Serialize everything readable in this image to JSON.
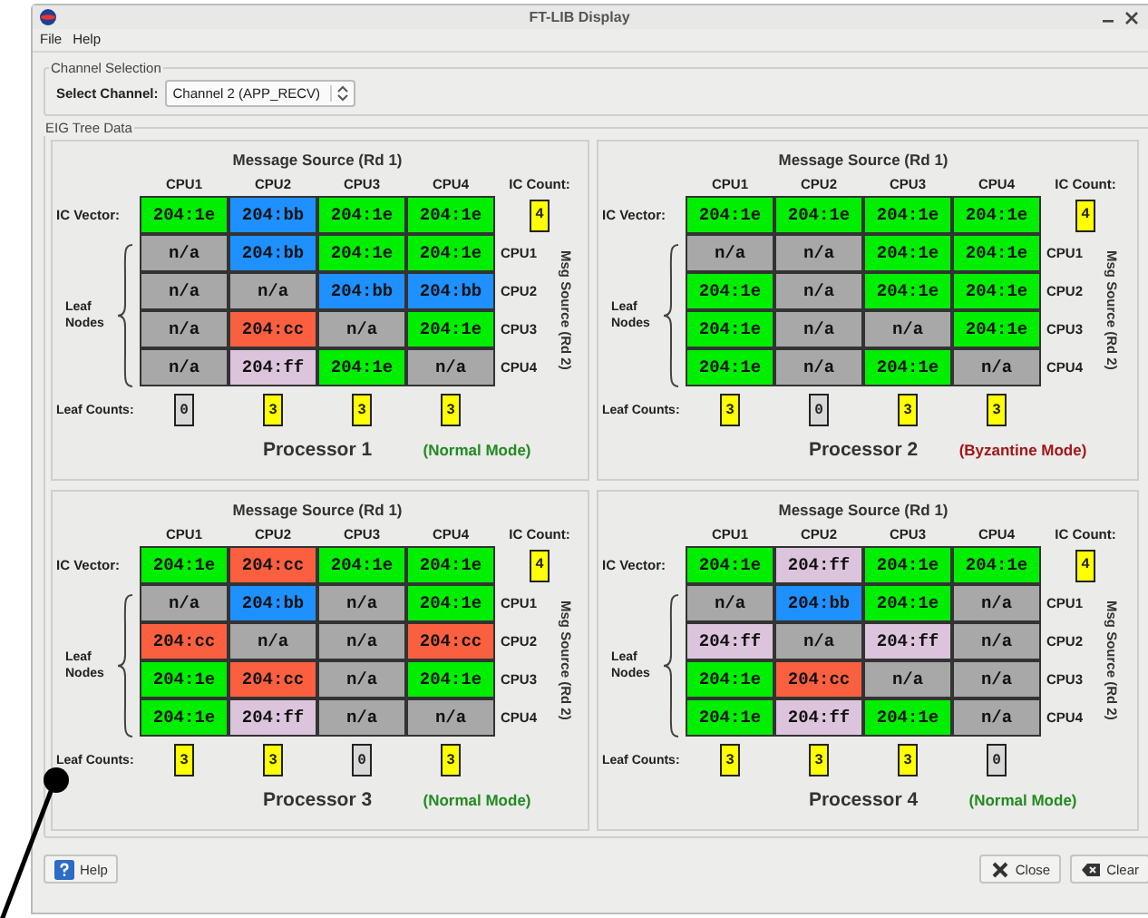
{
  "window": {
    "title": "FT-LIB Display"
  },
  "menu": [
    {
      "label": "File"
    },
    {
      "label": "Help"
    }
  ],
  "channel_selection": {
    "title": "Channel Selection",
    "label": "Select Channel:",
    "value": "Channel 2 (APP_RECV)"
  },
  "eig_tree": {
    "title": "EIG Tree Data",
    "processors": [
      {
        "heading": "Message Source (Rd 1)",
        "columns": [
          "CPU1",
          "CPU2",
          "CPU3",
          "CPU4"
        ],
        "ic_count_label": "IC Count:",
        "ic_vector_label": "IC Vector:",
        "ic_vector": [
          {
            "text": "204:1e",
            "color": "#00ee00"
          },
          {
            "text": "204:bb",
            "color": "#1e90ff"
          },
          {
            "text": "204:1e",
            "color": "#00ee00"
          },
          {
            "text": "204:1e",
            "color": "#00ee00"
          }
        ],
        "ic_count": {
          "text": "4",
          "color": "#ffff00"
        },
        "leaf_label": "Leaf Nodes",
        "side_label": "Msg Source (Rd 2)",
        "leaf_rows": [
          {
            "label": "CPU1",
            "cells": [
              {
                "text": "n/a",
                "color": "#a8a8a8"
              },
              {
                "text": "204:bb",
                "color": "#1e90ff"
              },
              {
                "text": "204:1e",
                "color": "#00ee00"
              },
              {
                "text": "204:1e",
                "color": "#00ee00"
              }
            ]
          },
          {
            "label": "CPU2",
            "cells": [
              {
                "text": "n/a",
                "color": "#a8a8a8"
              },
              {
                "text": "n/a",
                "color": "#a8a8a8"
              },
              {
                "text": "204:bb",
                "color": "#1e90ff"
              },
              {
                "text": "204:bb",
                "color": "#1e90ff"
              }
            ]
          },
          {
            "label": "CPU3",
            "cells": [
              {
                "text": "n/a",
                "color": "#a8a8a8"
              },
              {
                "text": "204:cc",
                "color": "#fa6040"
              },
              {
                "text": "n/a",
                "color": "#a8a8a8"
              },
              {
                "text": "204:1e",
                "color": "#00ee00"
              }
            ]
          },
          {
            "label": "CPU4",
            "cells": [
              {
                "text": "n/a",
                "color": "#a8a8a8"
              },
              {
                "text": "204:ff",
                "color": "#dcc4dc"
              },
              {
                "text": "204:1e",
                "color": "#00ee00"
              },
              {
                "text": "n/a",
                "color": "#a8a8a8"
              }
            ]
          }
        ],
        "leaf_counts_label": "Leaf Counts:",
        "leaf_counts": [
          {
            "text": "0",
            "color": "#d8d8d8"
          },
          {
            "text": "3",
            "color": "#ffff00"
          },
          {
            "text": "3",
            "color": "#ffff00"
          },
          {
            "text": "3",
            "color": "#ffff00"
          }
        ],
        "name": "Processor 1",
        "mode": {
          "text": "(Normal Mode)",
          "color": "#228b22"
        }
      },
      {
        "heading": "Message Source (Rd 1)",
        "columns": [
          "CPU1",
          "CPU2",
          "CPU3",
          "CPU4"
        ],
        "ic_count_label": "IC Count:",
        "ic_vector_label": "IC Vector:",
        "ic_vector": [
          {
            "text": "204:1e",
            "color": "#00ee00"
          },
          {
            "text": "204:1e",
            "color": "#00ee00"
          },
          {
            "text": "204:1e",
            "color": "#00ee00"
          },
          {
            "text": "204:1e",
            "color": "#00ee00"
          }
        ],
        "ic_count": {
          "text": "4",
          "color": "#ffff00"
        },
        "leaf_label": "Leaf Nodes",
        "side_label": "Msg Source (Rd 2)",
        "leaf_rows": [
          {
            "label": "CPU1",
            "cells": [
              {
                "text": "n/a",
                "color": "#a8a8a8"
              },
              {
                "text": "n/a",
                "color": "#a8a8a8"
              },
              {
                "text": "204:1e",
                "color": "#00ee00"
              },
              {
                "text": "204:1e",
                "color": "#00ee00"
              }
            ]
          },
          {
            "label": "CPU2",
            "cells": [
              {
                "text": "204:1e",
                "color": "#00ee00"
              },
              {
                "text": "n/a",
                "color": "#a8a8a8"
              },
              {
                "text": "204:1e",
                "color": "#00ee00"
              },
              {
                "text": "204:1e",
                "color": "#00ee00"
              }
            ]
          },
          {
            "label": "CPU3",
            "cells": [
              {
                "text": "204:1e",
                "color": "#00ee00"
              },
              {
                "text": "n/a",
                "color": "#a8a8a8"
              },
              {
                "text": "n/a",
                "color": "#a8a8a8"
              },
              {
                "text": "204:1e",
                "color": "#00ee00"
              }
            ]
          },
          {
            "label": "CPU4",
            "cells": [
              {
                "text": "204:1e",
                "color": "#00ee00"
              },
              {
                "text": "n/a",
                "color": "#a8a8a8"
              },
              {
                "text": "204:1e",
                "color": "#00ee00"
              },
              {
                "text": "n/a",
                "color": "#a8a8a8"
              }
            ]
          }
        ],
        "leaf_counts_label": "Leaf Counts:",
        "leaf_counts": [
          {
            "text": "3",
            "color": "#ffff00"
          },
          {
            "text": "0",
            "color": "#d8d8d8"
          },
          {
            "text": "3",
            "color": "#ffff00"
          },
          {
            "text": "3",
            "color": "#ffff00"
          }
        ],
        "name": "Processor 2",
        "mode": {
          "text": "(Byzantine Mode)",
          "color": "#a01818"
        }
      },
      {
        "heading": "Message Source (Rd 1)",
        "columns": [
          "CPU1",
          "CPU2",
          "CPU3",
          "CPU4"
        ],
        "ic_count_label": "IC Count:",
        "ic_vector_label": "IC Vector:",
        "ic_vector": [
          {
            "text": "204:1e",
            "color": "#00ee00"
          },
          {
            "text": "204:cc",
            "color": "#fa6040"
          },
          {
            "text": "204:1e",
            "color": "#00ee00"
          },
          {
            "text": "204:1e",
            "color": "#00ee00"
          }
        ],
        "ic_count": {
          "text": "4",
          "color": "#ffff00"
        },
        "leaf_label": "Leaf Nodes",
        "side_label": "Msg Source (Rd 2)",
        "leaf_rows": [
          {
            "label": "CPU1",
            "cells": [
              {
                "text": "n/a",
                "color": "#a8a8a8"
              },
              {
                "text": "204:bb",
                "color": "#1e90ff"
              },
              {
                "text": "n/a",
                "color": "#a8a8a8"
              },
              {
                "text": "204:1e",
                "color": "#00ee00"
              }
            ]
          },
          {
            "label": "CPU2",
            "cells": [
              {
                "text": "204:cc",
                "color": "#fa6040"
              },
              {
                "text": "n/a",
                "color": "#a8a8a8"
              },
              {
                "text": "n/a",
                "color": "#a8a8a8"
              },
              {
                "text": "204:cc",
                "color": "#fa6040"
              }
            ]
          },
          {
            "label": "CPU3",
            "cells": [
              {
                "text": "204:1e",
                "color": "#00ee00"
              },
              {
                "text": "204:cc",
                "color": "#fa6040"
              },
              {
                "text": "n/a",
                "color": "#a8a8a8"
              },
              {
                "text": "204:1e",
                "color": "#00ee00"
              }
            ]
          },
          {
            "label": "CPU4",
            "cells": [
              {
                "text": "204:1e",
                "color": "#00ee00"
              },
              {
                "text": "204:ff",
                "color": "#dcc4dc"
              },
              {
                "text": "n/a",
                "color": "#a8a8a8"
              },
              {
                "text": "n/a",
                "color": "#a8a8a8"
              }
            ]
          }
        ],
        "leaf_counts_label": "Leaf Counts:",
        "leaf_counts": [
          {
            "text": "3",
            "color": "#ffff00"
          },
          {
            "text": "3",
            "color": "#ffff00"
          },
          {
            "text": "0",
            "color": "#d8d8d8"
          },
          {
            "text": "3",
            "color": "#ffff00"
          }
        ],
        "name": "Processor 3",
        "mode": {
          "text": "(Normal Mode)",
          "color": "#228b22"
        }
      },
      {
        "heading": "Message Source (Rd 1)",
        "columns": [
          "CPU1",
          "CPU2",
          "CPU3",
          "CPU4"
        ],
        "ic_count_label": "IC Count:",
        "ic_vector_label": "IC Vector:",
        "ic_vector": [
          {
            "text": "204:1e",
            "color": "#00ee00"
          },
          {
            "text": "204:ff",
            "color": "#dcc4dc"
          },
          {
            "text": "204:1e",
            "color": "#00ee00"
          },
          {
            "text": "204:1e",
            "color": "#00ee00"
          }
        ],
        "ic_count": {
          "text": "4",
          "color": "#ffff00"
        },
        "leaf_label": "Leaf Nodes",
        "side_label": "Msg Source (Rd 2)",
        "leaf_rows": [
          {
            "label": "CPU1",
            "cells": [
              {
                "text": "n/a",
                "color": "#a8a8a8"
              },
              {
                "text": "204:bb",
                "color": "#1e90ff"
              },
              {
                "text": "204:1e",
                "color": "#00ee00"
              },
              {
                "text": "n/a",
                "color": "#a8a8a8"
              }
            ]
          },
          {
            "label": "CPU2",
            "cells": [
              {
                "text": "204:ff",
                "color": "#dcc4dc"
              },
              {
                "text": "n/a",
                "color": "#a8a8a8"
              },
              {
                "text": "204:ff",
                "color": "#dcc4dc"
              },
              {
                "text": "n/a",
                "color": "#a8a8a8"
              }
            ]
          },
          {
            "label": "CPU3",
            "cells": [
              {
                "text": "204:1e",
                "color": "#00ee00"
              },
              {
                "text": "204:cc",
                "color": "#fa6040"
              },
              {
                "text": "n/a",
                "color": "#a8a8a8"
              },
              {
                "text": "n/a",
                "color": "#a8a8a8"
              }
            ]
          },
          {
            "label": "CPU4",
            "cells": [
              {
                "text": "204:1e",
                "color": "#00ee00"
              },
              {
                "text": "204:ff",
                "color": "#dcc4dc"
              },
              {
                "text": "204:1e",
                "color": "#00ee00"
              },
              {
                "text": "n/a",
                "color": "#a8a8a8"
              }
            ]
          }
        ],
        "leaf_counts_label": "Leaf Counts:",
        "leaf_counts": [
          {
            "text": "3",
            "color": "#ffff00"
          },
          {
            "text": "3",
            "color": "#ffff00"
          },
          {
            "text": "3",
            "color": "#ffff00"
          },
          {
            "text": "0",
            "color": "#d8d8d8"
          }
        ],
        "name": "Processor 4",
        "mode": {
          "text": "(Normal Mode)",
          "color": "#228b22"
        }
      }
    ]
  },
  "buttons": [
    {
      "label": "Help",
      "kind": "help"
    },
    {
      "label": "Close",
      "kind": "close"
    },
    {
      "label": "Clear",
      "kind": "clear"
    }
  ]
}
